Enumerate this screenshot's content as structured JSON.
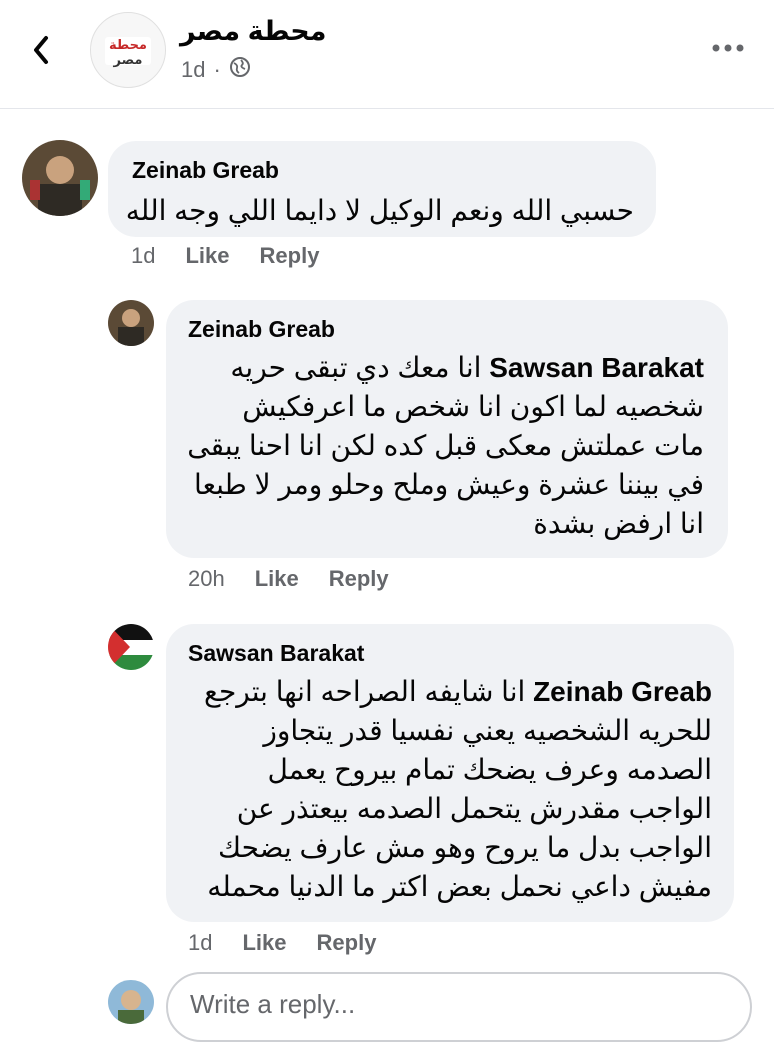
{
  "header": {
    "page_name": "محطة مصر",
    "post_time": "1d",
    "separator": "·",
    "logo_text_top": "محطة",
    "logo_text_bottom": "مصر"
  },
  "comments": [
    {
      "author": "Zeinab Greab",
      "text": "حسبي الله ونعم الوكيل لا دايما اللي وجه الله",
      "time": "1d",
      "like": "Like",
      "reply": "Reply"
    },
    {
      "author": "Zeinab Greab",
      "mention": "Sawsan Barakat",
      "text": "انا معك دي تبقى حريه شخصيه لما اكون انا شخص ما اعرفكيش مات عملتش معكى قبل كده لكن انا احنا يبقى في بيننا عشرة وعيش وملح وحلو ومر لا طبعا انا ارفض  بشدة",
      "time": "20h",
      "like": "Like",
      "reply": "Reply"
    },
    {
      "author": "Sawsan Barakat",
      "mention": "Zeinab Greab",
      "text": "انا شايفه الصراحه انها بترجع للحريه الشخصيه يعني نفسيا قدر يتجاوز الصدمه وعرف يضحك تمام بيروح يعمل الواجب مقدرش يتحمل الصدمه بيعتذر عن الواجب  بدل ما يروح وهو مش عارف يضحك مفيش داعي نحمل بعض اكتر ما الدنيا محمله",
      "time": "1d",
      "like": "Like",
      "reply": "Reply"
    }
  ],
  "reply_input": {
    "placeholder": "Write a reply..."
  },
  "icons": {
    "back": "back-arrow-icon",
    "privacy": "globe-icon",
    "more": "more-options-icon"
  },
  "colors": {
    "bubble": "#f0f2f5",
    "meta": "#65676b",
    "logo_red": "#c62828"
  }
}
